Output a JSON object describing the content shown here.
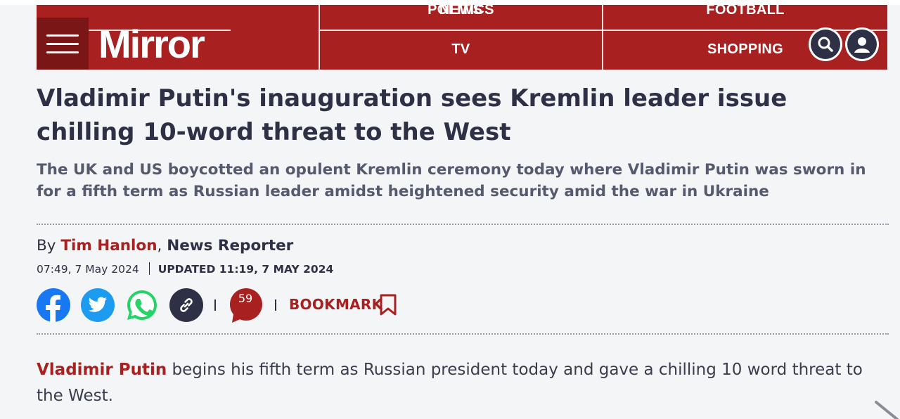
{
  "header": {
    "logo": "Mirror",
    "nav": {
      "news": "NEWS",
      "politics": "POLITICS",
      "football": "FOOTBALL",
      "tv": "TV",
      "shopping": "SHOPPING"
    },
    "colors": {
      "brand": "#a8201f",
      "menu_bg": "#7a1615",
      "icon_dark": "#2e3145"
    },
    "icons": {
      "menu": "hamburger-icon",
      "search": "search-icon",
      "account": "user-icon"
    }
  },
  "article": {
    "headline": "Vladimir Putin's inauguration sees Kremlin leader issue chilling 10-word threat to the West",
    "standfirst": "The UK and US boycotted an opulent Kremlin ceremony today where Vladimir Putin was sworn in for a fifth term as Russian leader amidst heightened security amid the war in Ukraine",
    "byline": {
      "by": "By",
      "author": "Tim Hanlon",
      "role": "News Reporter"
    },
    "published": "07:49, 7 May 2024",
    "updated": "UPDATED 11:19, 7 MAY 2024",
    "share": {
      "icons": [
        "facebook-icon",
        "twitter-icon",
        "whatsapp-icon",
        "link-icon"
      ],
      "comment_count": "59",
      "bookmark_label": "BOOKMARK"
    },
    "body": {
      "lead_link": "Vladimir Putin",
      "text": " begins his fifth term as Russian president today and gave a chilling 10 word threat to the West."
    }
  },
  "colors": {
    "background": "#f4f5f7",
    "text": "#2e3145",
    "facebook": "#1877f2",
    "twitter": "#1d9bf0",
    "whatsapp": "#25d366",
    "comments": "#a8201f"
  }
}
